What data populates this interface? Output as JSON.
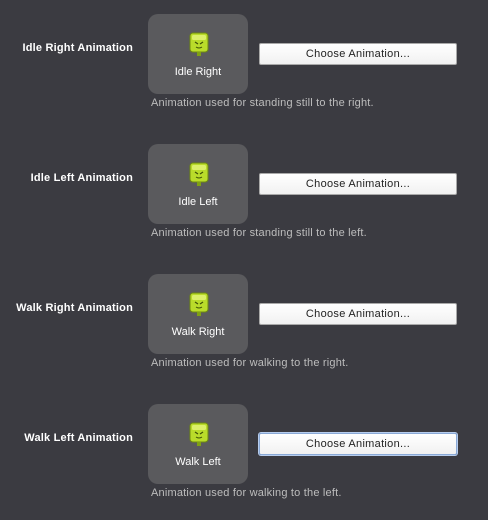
{
  "colors": {
    "background": "#3b3b41",
    "thumbnail_bg": "#5a5a5d",
    "sprite_green": "#b9dc2a",
    "focus_ring": "#8aa9d6"
  },
  "rows": [
    {
      "label": "Idle Right Animation",
      "thumb_label": "Idle Right",
      "button_label": "Choose Animation...",
      "description": "Animation used for standing still to the right.",
      "icon": "character-sprite-icon"
    },
    {
      "label": "Idle Left Animation",
      "thumb_label": "Idle Left",
      "button_label": "Choose Animation...",
      "description": "Animation used for standing still to the left.",
      "icon": "character-sprite-icon"
    },
    {
      "label": "Walk Right Animation",
      "thumb_label": "Walk Right",
      "button_label": "Choose Animation...",
      "description": "Animation used for walking to the right.",
      "icon": "character-sprite-icon"
    },
    {
      "label": "Walk Left Animation",
      "thumb_label": "Walk Left",
      "button_label": "Choose Animation...",
      "description": "Animation used for walking to the left.",
      "icon": "character-sprite-icon",
      "focused": true
    }
  ]
}
